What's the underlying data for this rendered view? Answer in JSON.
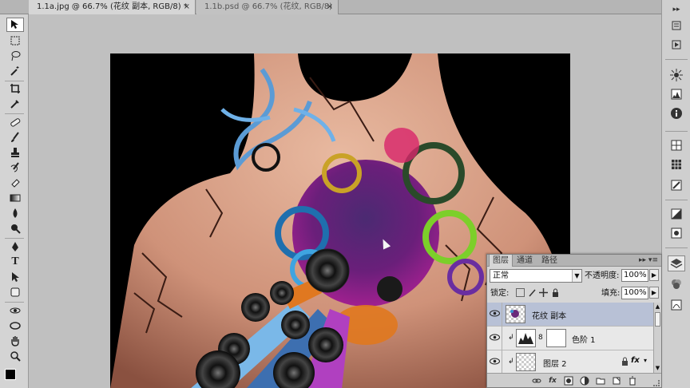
{
  "tabs": [
    {
      "label": "1.1a.jpg @ 66.7% (花纹 副本, RGB/8) *",
      "close": "×",
      "active": true
    },
    {
      "label": "1.1b.psd @ 66.7% (花纹, RGB/8)",
      "close": "×",
      "active": false
    }
  ],
  "tools": [
    "move-tool",
    "marquee-tool",
    "lasso-tool",
    "magic-wand-tool",
    "crop-tool",
    "eyedropper-tool",
    "healing-brush-tool",
    "brush-tool",
    "clone-stamp-tool",
    "history-brush-tool",
    "eraser-tool",
    "gradient-tool",
    "blur-tool",
    "dodge-tool",
    "pen-tool",
    "type-tool",
    "path-selection-tool",
    "shape-tool",
    "3d-rotate-tool",
    "3d-orbit-tool",
    "hand-tool",
    "zoom-tool"
  ],
  "tool_glyphs": {
    "type": "T"
  },
  "layers_panel": {
    "tabs": [
      "图层",
      "通道",
      "路径"
    ],
    "menu": "▸▸ ▾≡",
    "blend_mode": "正常",
    "opacity_label": "不透明度:",
    "opacity_value": "100%",
    "lock_label": "锁定:",
    "fill_label": "填充:",
    "fill_value": "100%",
    "layers": [
      {
        "name": "花纹 副本",
        "selected": true
      },
      {
        "name": "色阶 1",
        "selected": false
      },
      {
        "name": "图层 2",
        "selected": false
      }
    ],
    "layer_fx": "fx",
    "footer_icons": [
      "link-icon",
      "fx-icon",
      "mask-icon",
      "adjustment-icon",
      "group-icon",
      "new-layer-icon",
      "trash-icon"
    ],
    "footer_glyphs": {
      "fx": "fx"
    }
  },
  "dock_icons": [
    "dock-menu-icon",
    "history-icon",
    "actions-icon",
    "navigator-icon",
    "histogram-icon",
    "info-icon",
    "swatches-icon",
    "styles-icon",
    "3d-icon",
    "masks-icon",
    "layers-icon",
    "channels-icon",
    "paths-icon"
  ],
  "colors": {
    "canvas_bg": "#000000",
    "workspace": "#c0c0c0",
    "selected_layer": "#b8c1d6",
    "toolbox": "#d4d4d4"
  }
}
